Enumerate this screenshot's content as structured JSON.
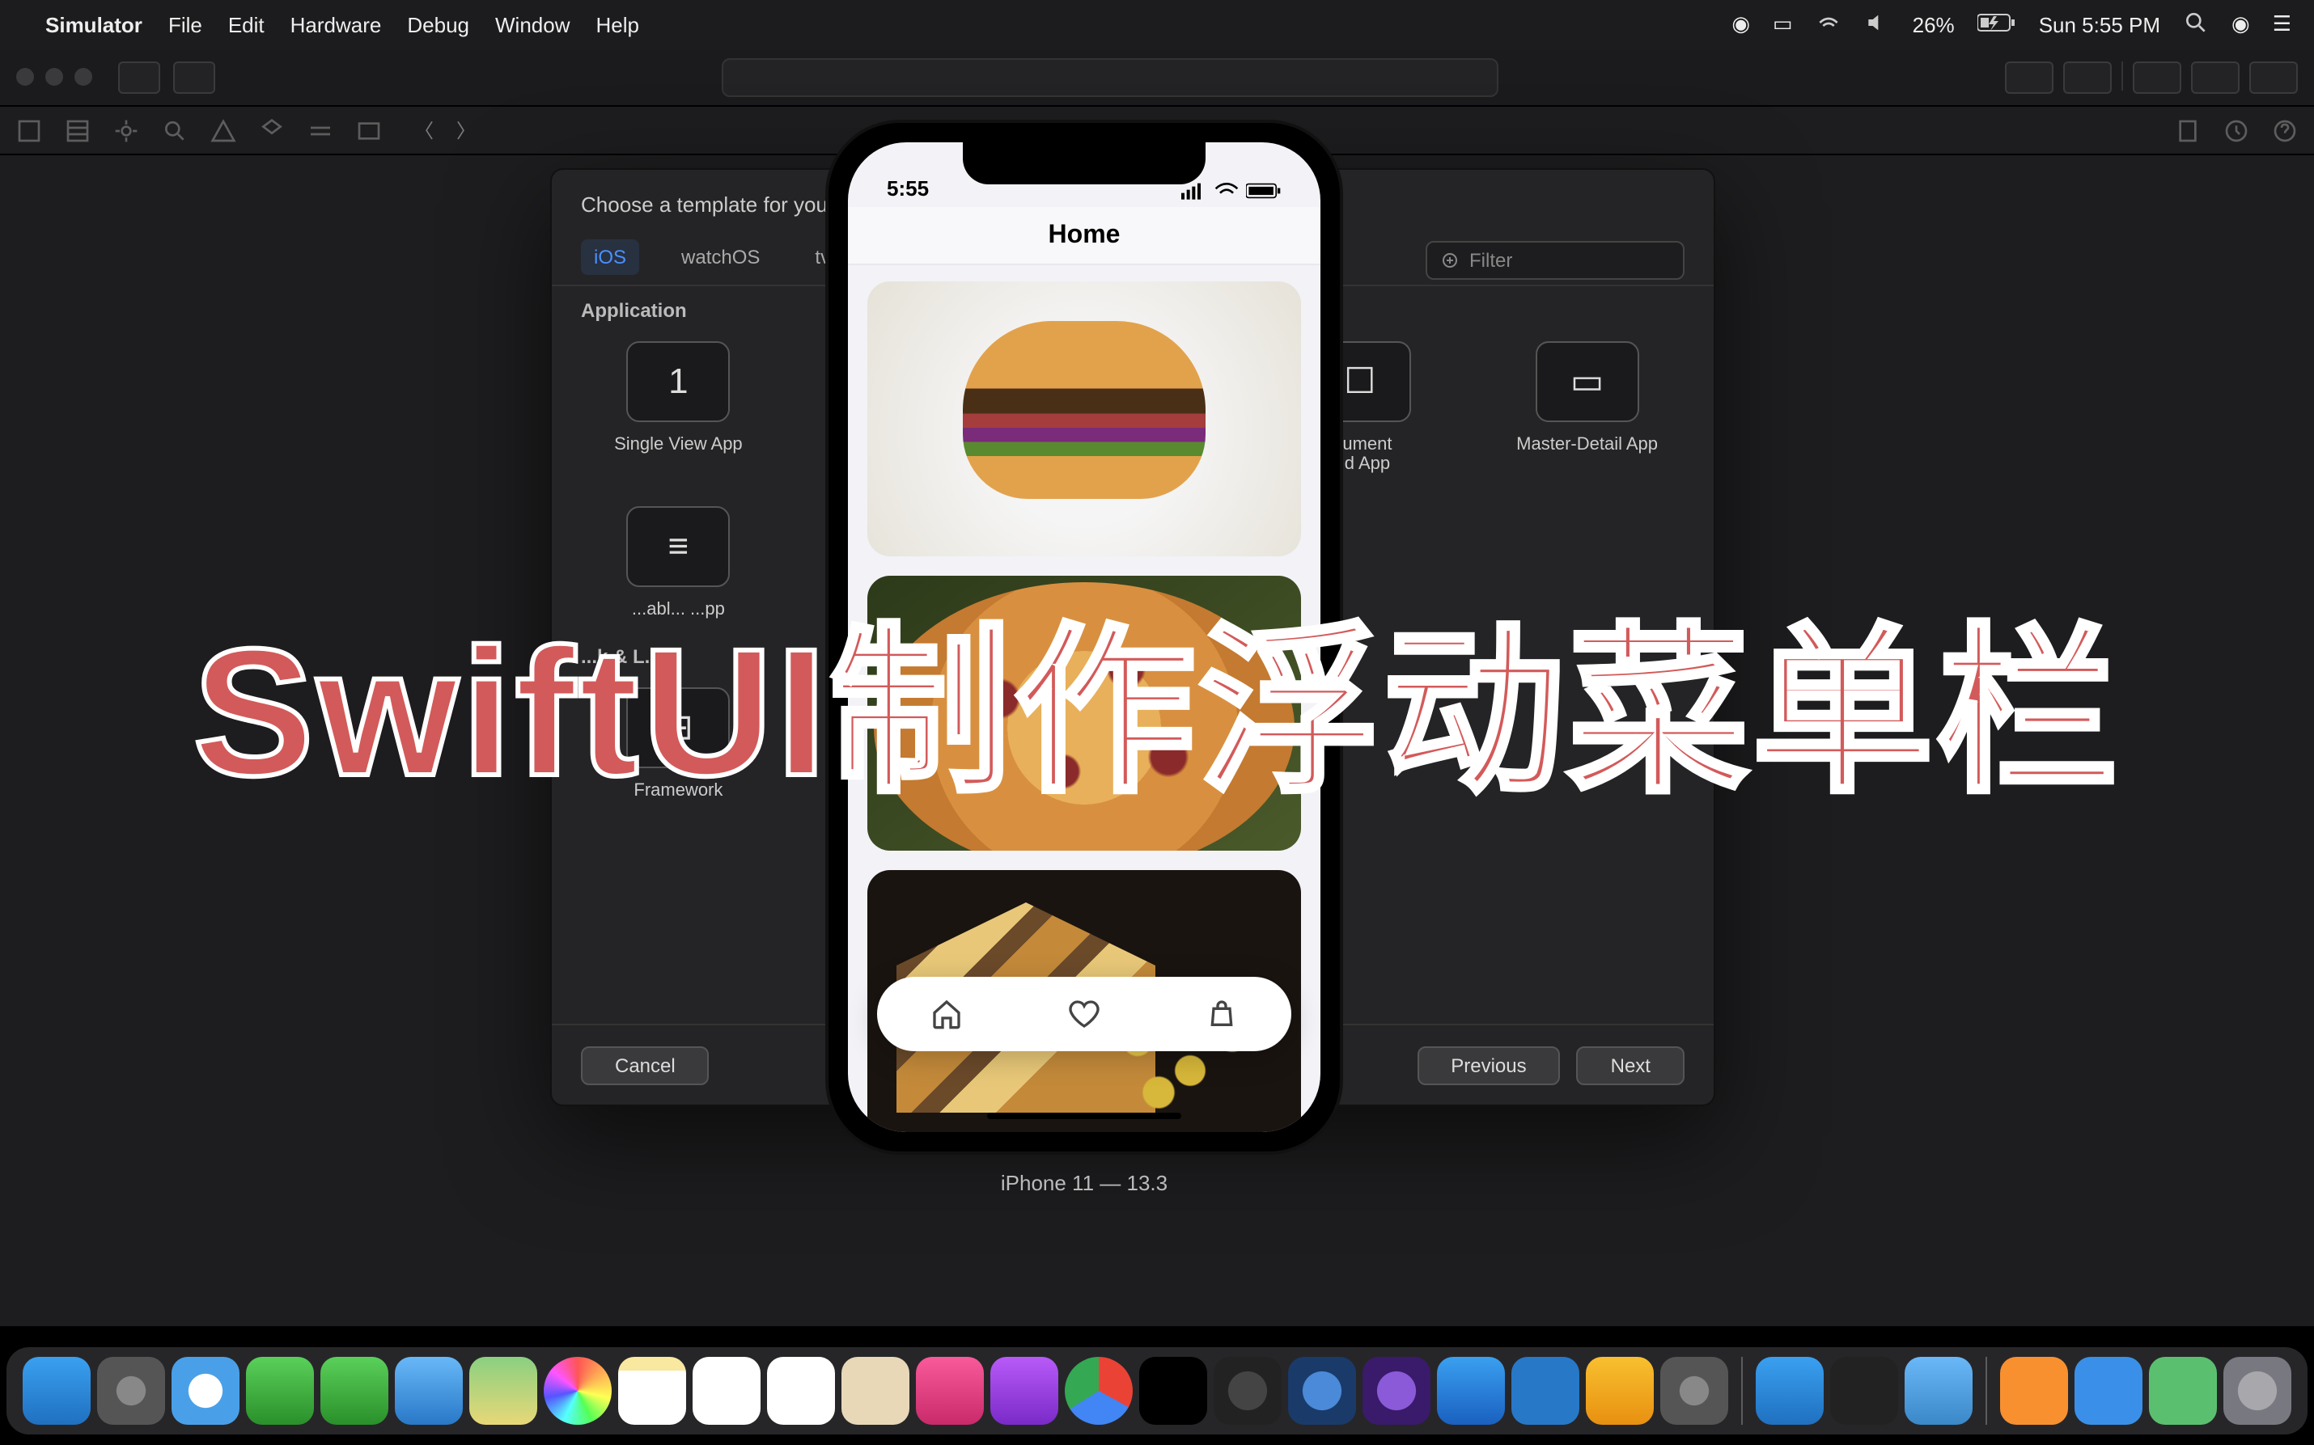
{
  "menubar": {
    "app_name": "Simulator",
    "items": [
      "File",
      "Edit",
      "Hardware",
      "Debug",
      "Window",
      "Help"
    ],
    "battery": "26%",
    "clock": "Sun 5:55 PM"
  },
  "xcode": {
    "sheet": {
      "title": "Choose a template for your",
      "tabs": [
        "iOS",
        "watchOS",
        "tvOS"
      ],
      "active_tab": "iOS",
      "filter_placeholder": "Filter",
      "section": "Application",
      "templates_row1": [
        {
          "label": "Single View App",
          "glyph": "1"
        },
        {
          "label": "",
          "glyph": ""
        },
        {
          "label": "",
          "glyph": ""
        },
        {
          "label": "...ument\n...d App",
          "glyph": "☐"
        },
        {
          "label": "Master-Detail App",
          "glyph": "▭"
        }
      ],
      "templates_row2": [
        {
          "label": "...abl... ...pp",
          "glyph": "≡"
        },
        {
          "label": "",
          "glyph": ""
        },
        {
          "label": "",
          "glyph": ""
        },
        {
          "label": "",
          "glyph": ""
        },
        {
          "label": "",
          "glyph": ""
        }
      ],
      "section2": "...k & L...ry",
      "templates_row3": [
        {
          "label": "Framework",
          "glyph": "⊞"
        },
        {
          "label": "",
          "glyph": ""
        },
        {
          "label": "",
          "glyph": ""
        },
        {
          "label": "",
          "glyph": ""
        },
        {
          "label": "",
          "glyph": ""
        }
      ],
      "cancel": "Cancel",
      "previous": "Previous",
      "next": "Next"
    }
  },
  "phone": {
    "status_time": "5:55",
    "nav_title": "Home",
    "label": "iPhone 11 — 13.3",
    "tabbar_icons": [
      "home-icon",
      "heart-icon",
      "bag-icon"
    ]
  },
  "overlay": "SwiftUI制作浮动菜单栏",
  "dock": {
    "apps": [
      "finder",
      "launchpad",
      "safari",
      "messages",
      "facetime",
      "mail",
      "maps",
      "photos",
      "notes",
      "cal",
      "reminders",
      "contacts",
      "music",
      "podcasts",
      "chrome",
      "appletv",
      "fcp",
      "motion",
      "imovie",
      "appstore",
      "vscode",
      "sketch",
      "sysprefs"
    ],
    "right": [
      "xcode",
      "terminal",
      "folder"
    ],
    "far_right": [
      "pages",
      "keynote",
      "numbers",
      "trash"
    ]
  }
}
